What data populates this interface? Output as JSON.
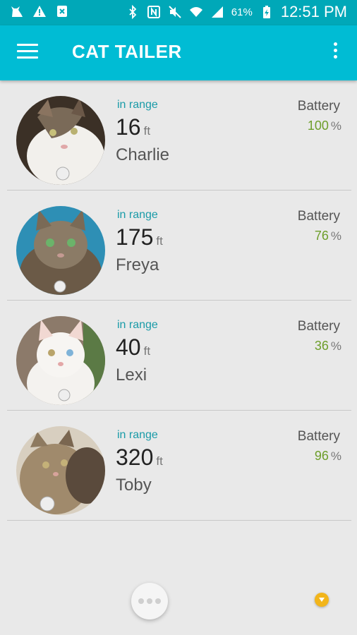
{
  "status": {
    "battery_pct": "61%",
    "time": "12:51 PM"
  },
  "app": {
    "title": "CAT TAILER"
  },
  "cats": [
    {
      "range": "in range",
      "distance": "16",
      "unit": "ft",
      "name": "Charlie",
      "battery_label": "Battery",
      "battery": "100",
      "pct": "%"
    },
    {
      "range": "in range",
      "distance": "175",
      "unit": "ft",
      "name": "Freya",
      "battery_label": "Battery",
      "battery": "76",
      "pct": "%"
    },
    {
      "range": "in range",
      "distance": "40",
      "unit": "ft",
      "name": "Lexi",
      "battery_label": "Battery",
      "battery": "36",
      "pct": "%"
    },
    {
      "range": "in range",
      "distance": "320",
      "unit": "ft",
      "name": "Toby",
      "battery_label": "Battery",
      "battery": "96",
      "pct": "%"
    }
  ],
  "colors": {
    "toolbar": "#00bcd4",
    "statusbar": "#00a8b8",
    "range": "#1a9ba8",
    "battery": "#6d9e2a",
    "accent": "#f2b51b"
  }
}
